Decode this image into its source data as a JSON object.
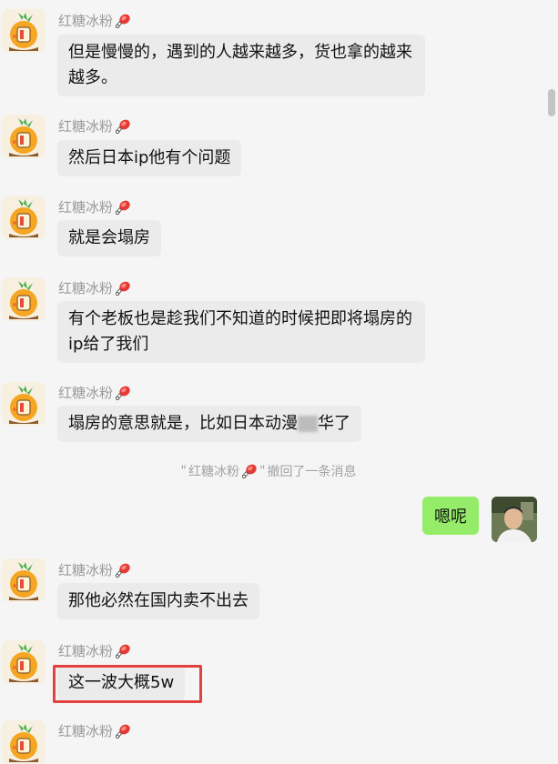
{
  "sender_name": "红糖冰粉",
  "messages": [
    {
      "text": "但是慢慢的，遇到的人越来越多，货也拿的越来越多。"
    },
    {
      "text": "然后日本ip他有个问题"
    },
    {
      "text": "就是会塌房"
    },
    {
      "text": "有个老板也是趁我们不知道的时候把即将塌房的ip给了我们"
    },
    {
      "text_before": "塌房的意思就是，比如日本动漫",
      "text_after": "华了"
    },
    {
      "text": "那他必然在国内卖不出去"
    },
    {
      "text": "这一波大概5w"
    }
  ],
  "system": {
    "quote_open": "\"",
    "quote_close": "\"",
    "recalled_suffix": " 撤回了一条消息"
  },
  "my_message": {
    "text": "嗯呢"
  },
  "icons": {
    "avatar": "cartoon-carrot-avatar-icon",
    "name_emoji": "drumstick-emoji-icon",
    "my_avatar": "user-photo-avatar"
  },
  "colors": {
    "my_bubble": "#95ec69",
    "their_bubble": "#ebebeb",
    "highlight_border": "#e34040"
  }
}
